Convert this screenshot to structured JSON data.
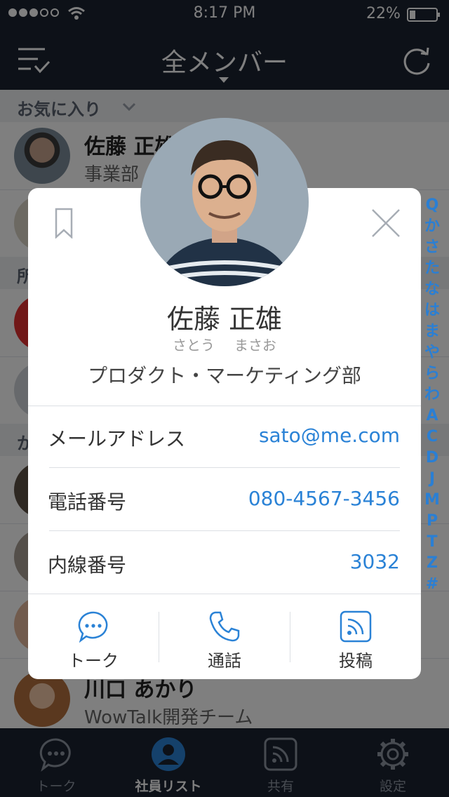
{
  "status": {
    "time": "8:17 PM",
    "battery": "22%"
  },
  "nav": {
    "title": "全メンバー"
  },
  "sections": {
    "favorites": "お気に入り",
    "affiliation": "所",
    "ka": "か"
  },
  "list": [
    {
      "name": "佐藤 正雄",
      "dept": "事業部"
    },
    {
      "name": "川口 あかり",
      "dept": "WowTalk開発チーム"
    }
  ],
  "index_letters": [
    "Q",
    "か",
    "さ",
    "た",
    "な",
    "は",
    "ま",
    "や",
    "ら",
    "わ",
    "A",
    "C",
    "D",
    "J",
    "M",
    "P",
    "T",
    "Z",
    "#"
  ],
  "tabs": [
    {
      "label": "トーク",
      "icon": "chat-icon"
    },
    {
      "label": "社員リスト",
      "icon": "person-icon"
    },
    {
      "label": "共有",
      "icon": "rss-icon"
    },
    {
      "label": "設定",
      "icon": "gear-icon"
    }
  ],
  "profile": {
    "name": "佐藤 正雄",
    "kana_family": "さとう",
    "kana_given": "まさお",
    "department": "プロダクト・マーケティング部",
    "fields": [
      {
        "label": "メールアドレス",
        "value": "sato@me.com"
      },
      {
        "label": "電話番号",
        "value": "080-4567-3456"
      },
      {
        "label": "内線番号",
        "value": "3032"
      }
    ],
    "actions": [
      {
        "label": "トーク",
        "icon": "chat-icon"
      },
      {
        "label": "通話",
        "icon": "phone-icon"
      },
      {
        "label": "投稿",
        "icon": "rss-icon"
      }
    ]
  },
  "colors": {
    "nav_bg": "#1b2231",
    "accent": "#2a82d6"
  }
}
